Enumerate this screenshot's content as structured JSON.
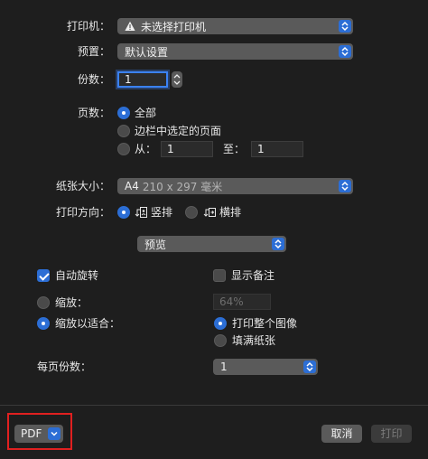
{
  "printer": {
    "label": "打印机：",
    "value": "未选择打印机",
    "warning_icon": "warning-triangle-icon"
  },
  "preset": {
    "label": "预置：",
    "value": "默认设置"
  },
  "copies": {
    "label": "份数：",
    "value": "1"
  },
  "pages": {
    "label": "页数：",
    "options": {
      "all": "全部",
      "selection": "边栏中选定的页面",
      "from": "从：",
      "to": "至："
    },
    "from_value": "1",
    "to_value": "1"
  },
  "paper_size": {
    "label": "纸张大小：",
    "size_name": "A4",
    "size_detail": "210 x 297 毫米"
  },
  "orientation": {
    "label": "打印方向：",
    "portrait": "竖排",
    "landscape": "横排",
    "selected": "portrait"
  },
  "section_popup": {
    "value": "预览"
  },
  "preview_options": {
    "auto_rotate": "自动旋转",
    "show_notes": "显示备注",
    "scale": "缩放：",
    "scale_value": "64%",
    "scale_to_fit": "缩放以适合：",
    "print_entire_image": "打印整个图像",
    "fill_paper": "填满纸张"
  },
  "pages_per_sheet": {
    "label": "每页份数：",
    "value": "1"
  },
  "footer": {
    "pdf": "PDF",
    "cancel": "取消",
    "print": "打印"
  },
  "colors": {
    "accent": "#2c6ed5",
    "highlight": "#e02020",
    "background": "#1e1e1e"
  }
}
